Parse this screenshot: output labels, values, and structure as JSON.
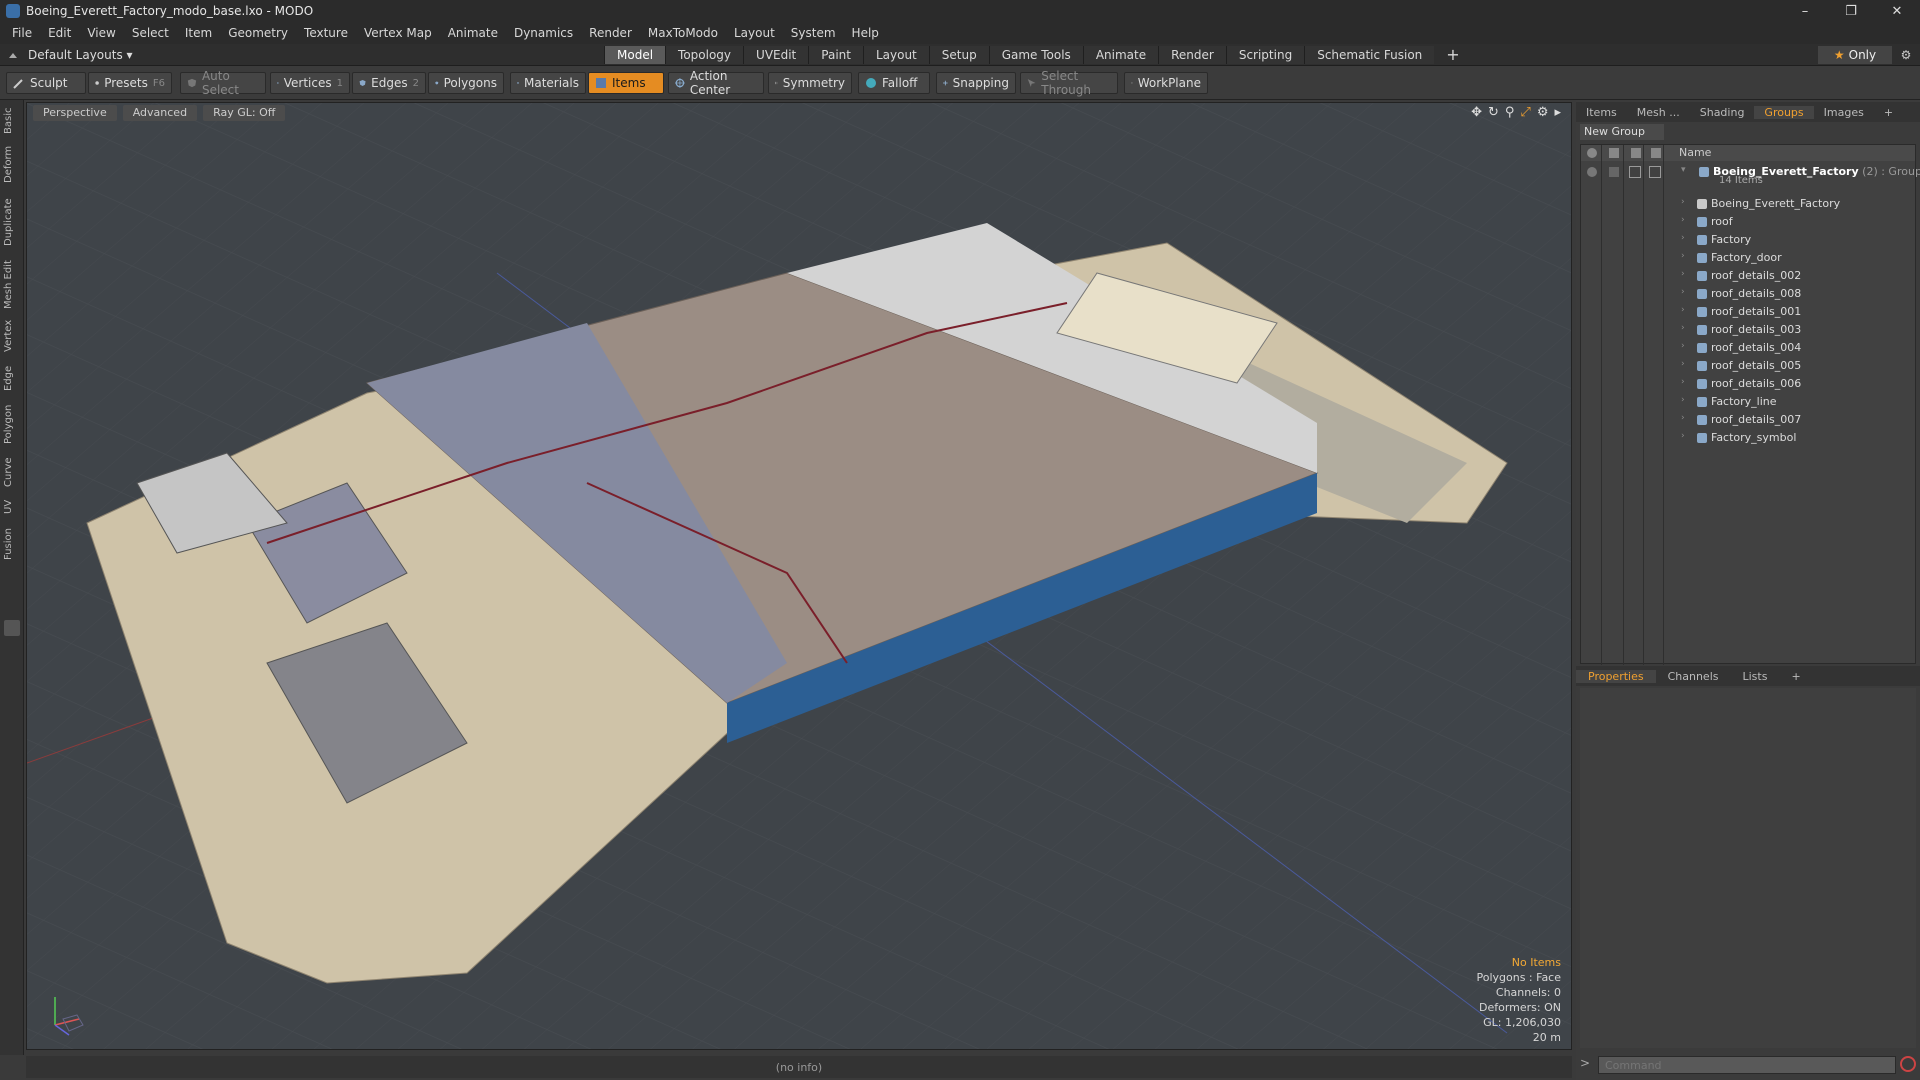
{
  "window": {
    "title": "Boeing_Everett_Factory_modo_base.lxo - MODO",
    "controls": [
      "–",
      "❐",
      "✕"
    ]
  },
  "menu": [
    "File",
    "Edit",
    "View",
    "Select",
    "Item",
    "Geometry",
    "Texture",
    "Vertex Map",
    "Animate",
    "Dynamics",
    "Render",
    "MaxToModo",
    "Layout",
    "System",
    "Help"
  ],
  "layout": {
    "label": "Default Layouts ▾"
  },
  "tabs": {
    "model": "Model",
    "topology": "Topology",
    "uvedit": "UVEdit",
    "paint": "Paint",
    "layout": "Layout",
    "setup": "Setup",
    "gametools": "Game Tools",
    "animate": "Animate",
    "render": "Render",
    "scripting": "Scripting",
    "schematic": "Schematic Fusion",
    "plus": "+"
  },
  "only": {
    "label": "Only"
  },
  "toolbar": {
    "sculpt": "Sculpt",
    "presets": "Presets",
    "presets_key": "F6",
    "autoselect": "Auto Select",
    "vertices": "Vertices",
    "vertices_key": "1",
    "edges": "Edges",
    "edges_key": "2",
    "polygons": "Polygons",
    "materials": "Materials",
    "items": "Items",
    "actioncenter": "Action Center",
    "symmetry": "Symmetry",
    "falloff": "Falloff",
    "snapping": "Snapping",
    "selectthrough": "Select Through",
    "workplane": "WorkPlane"
  },
  "leftstrip": [
    "Basic",
    "Deform",
    "Duplicate",
    "Mesh Edit",
    "Vertex",
    "Edge",
    "Polygon",
    "Curve",
    "UV",
    "Fusion"
  ],
  "viewport": {
    "view": "Perspective",
    "advanced": "Advanced",
    "raygl": "Ray GL: Off",
    "stats": {
      "noitems": "No Items",
      "polygons": "Polygons : Face",
      "channels": "Channels: 0",
      "deformers": "Deformers: ON",
      "gl": "GL: 1,206,030",
      "scale": "20 m"
    }
  },
  "status": {
    "info": "(no info)"
  },
  "rpanel": {
    "tabs": {
      "items": "Items",
      "mesh": "Mesh ...",
      "shading": "Shading",
      "groups": "Groups",
      "images": "Images",
      "plus": "+"
    },
    "newgroup": "New Group",
    "header_name": "Name",
    "group": {
      "name": "Boeing_Everett_Factory",
      "suffix": " (2) : Group",
      "count": "14 Items"
    },
    "items": [
      "Boeing_Everett_Factory",
      "roof",
      "Factory",
      "Factory_door",
      "roof_details_002",
      "roof_details_008",
      "roof_details_001",
      "roof_details_003",
      "roof_details_004",
      "roof_details_005",
      "roof_details_006",
      "Factory_line",
      "roof_details_007",
      "Factory_symbol"
    ],
    "ptabs": {
      "properties": "Properties",
      "channels": "Channels",
      "lists": "Lists",
      "plus": "+"
    },
    "command_placeholder": "Command"
  },
  "colors": {
    "accent": "#e58c22",
    "viewport_bg": "#3f4449",
    "panel_bg": "#3b3b3b"
  }
}
